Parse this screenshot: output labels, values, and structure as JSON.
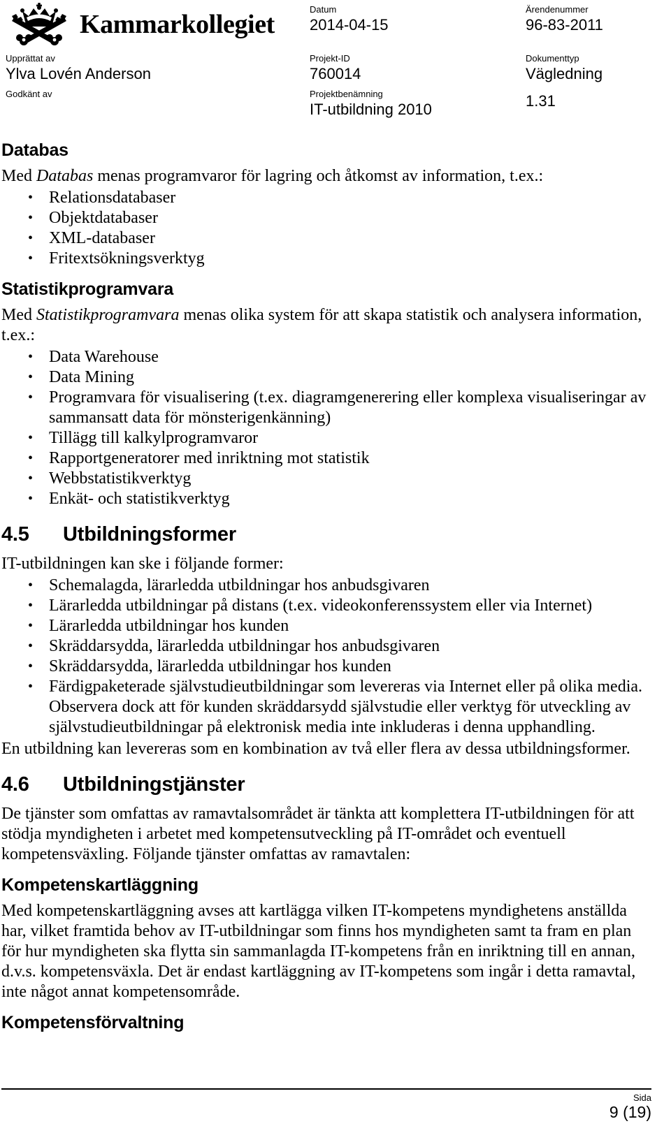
{
  "header": {
    "logo_icon": "crown-crossed-keys-icon",
    "organization": "Kammarkollegiet",
    "fields": {
      "datum_label": "Datum",
      "datum_value": "2014-04-15",
      "arendenummer_label": "Ärendenummer",
      "arendenummer_value": "96-83-2011",
      "upprattat_label": "Upprättat av",
      "upprattat_value": "Ylva Lovén Anderson",
      "godkant_label": "Godkänt av",
      "godkant_value": "",
      "projektid_label": "Projekt-ID",
      "projektid_value": "760014",
      "projektbenamning_label": "Projektbenämning",
      "projektbenamning_value": "IT-utbildning 2010",
      "dokumenttyp_label": "Dokumenttyp",
      "dokumenttyp_value": "Vägledning",
      "version_value": "1.31"
    }
  },
  "body": {
    "databas": {
      "heading": "Databas",
      "intro_pre": "Med ",
      "intro_em": "Databas",
      "intro_post": " menas programvaror för lagring och åtkomst av information, t.ex.:",
      "bullets": [
        "Relationsdatabaser",
        "Objektdatabaser",
        "XML-databaser",
        "Fritextsökningsverktyg"
      ]
    },
    "statistik": {
      "heading": "Statistikprogramvara",
      "intro_pre": "Med ",
      "intro_em": "Statistikprogramvara",
      "intro_post": " menas olika system för att skapa statistik och analysera information, t.ex.:",
      "bullets": [
        "Data Warehouse",
        "Data Mining",
        "Programvara för visualisering (t.ex. diagramgenerering eller komplexa visualiseringar av sammansatt data för mönsterigenkänning)",
        "Tillägg till kalkylprogramvaror",
        "Rapportgeneratorer med inriktning mot statistik",
        "Webbstatistikverktyg",
        "Enkät- och statistikverktyg"
      ]
    },
    "section_45": {
      "number": "4.5",
      "title": "Utbildningsformer",
      "intro": "IT-utbildningen kan ske i följande former:",
      "bullets": [
        "Schemalagda, lärarledda utbildningar hos anbudsgivaren",
        "Lärarledda utbildningar på distans (t.ex. videokonferenssystem eller via Internet)",
        "Lärarledda utbildningar hos kunden",
        "Skräddarsydda, lärarledda utbildningar hos anbudsgivaren",
        "Skräddarsydda, lärarledda utbildningar hos kunden",
        "Färdigpaketerade självstudieutbildningar som levereras via Internet eller på olika media. Observera dock att för kunden skräddarsydd självstudie eller verktyg för utveckling av självstudieutbildningar på elektronisk media inte inkluderas i denna upphandling."
      ],
      "outro": "En utbildning kan levereras som en kombination av två eller flera av dessa utbildningsformer."
    },
    "section_46": {
      "number": "4.6",
      "title": "Utbildningstjänster",
      "intro": "De tjänster som omfattas av ramavtalsområdet är tänkta att komplettera IT-utbildningen för att stödja myndigheten i arbetet med kompetensutveckling på IT-området och eventuell kompetensväxling. Följande tjänster omfattas av ramavtalen:"
    },
    "kompetenskartlaggning": {
      "heading": "Kompetenskartläggning",
      "paragraph": "Med kompetenskartläggning avses att kartlägga vilken IT-kompetens myndighetens anställda har, vilket framtida behov av IT-utbildningar som finns hos myndigheten samt ta fram en plan för hur myndigheten ska flytta sin sammanlagda IT-kompetens från en inriktning till en annan, d.v.s. kompetensväxla. Det är endast kartläggning av IT-kompetens som ingår i detta ramavtal, inte något annat kompetensområde."
    },
    "kompetensforvaltning": {
      "heading": "Kompetensförvaltning"
    }
  },
  "footer": {
    "page_label": "Sida",
    "page_value": "9 (19)"
  }
}
